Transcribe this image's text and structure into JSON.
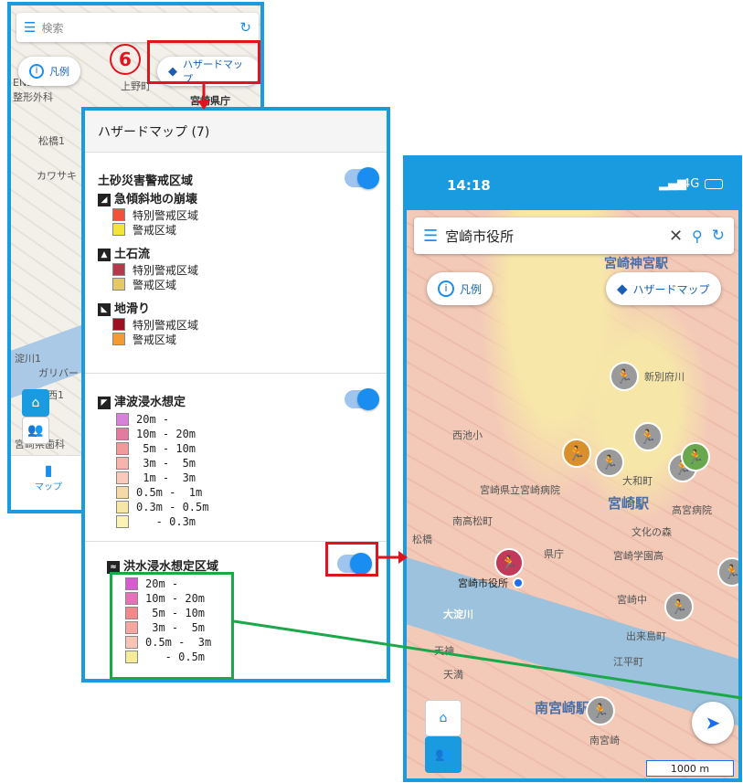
{
  "phone1": {
    "search_placeholder": "検索",
    "legend_label": "凡例",
    "hazard_label": "ハザードマップ",
    "nav_label": "マップ",
    "map_labels": [
      "ENEOS",
      "整形外科",
      "上野町",
      "宮崎県庁",
      "松橋1",
      "カワサキ",
      "淀川1",
      "ガリバー",
      "中村西1",
      "宮崎県歯科"
    ]
  },
  "hazard_panel": {
    "title": "ハザードマップ (7)",
    "landslide": {
      "title": "土砂災害警戒区域",
      "groups": [
        {
          "name": "急傾斜地の崩壊",
          "items": [
            {
              "label": "特別警戒区域",
              "color": "#f0533a"
            },
            {
              "label": "警戒区域",
              "color": "#f6e33a"
            }
          ]
        },
        {
          "name": "土石流",
          "items": [
            {
              "label": "特別警戒区域",
              "color": "#b23a4a"
            },
            {
              "label": "警戒区域",
              "color": "#e4c86a"
            }
          ]
        },
        {
          "name": "地滑り",
          "items": [
            {
              "label": "特別警戒区域",
              "color": "#9c1020"
            },
            {
              "label": "警戒区域",
              "color": "#f49a34"
            }
          ]
        }
      ]
    },
    "tsunami": {
      "title": "津波浸水想定",
      "items": [
        {
          "label": "20m -",
          "color": "#d582d8"
        },
        {
          "label": "10m - 20m",
          "color": "#e37aa0"
        },
        {
          "label": " 5m - 10m",
          "color": "#f19a9c"
        },
        {
          "label": " 3m -  5m",
          "color": "#f6b4ae"
        },
        {
          "label": " 1m -  3m",
          "color": "#f8c9bc"
        },
        {
          "label": "0.5m -  1m",
          "color": "#f6d9a8"
        },
        {
          "label": "0.3m - 0.5m",
          "color": "#f7e7a6"
        },
        {
          "label": "   - 0.3m",
          "color": "#fbf3b6"
        }
      ]
    },
    "flood": {
      "title": "洪水浸水想定区域",
      "items": [
        {
          "label": "20m -",
          "color": "#d45bd0"
        },
        {
          "label": "10m - 20m",
          "color": "#e472b8"
        },
        {
          "label": " 5m - 10m",
          "color": "#f08a8a"
        },
        {
          "label": " 3m -  5m",
          "color": "#f6a6a0"
        },
        {
          "label": "0.5m -  3m",
          "color": "#f8c4b6"
        },
        {
          "label": "   - 0.5m",
          "color": "#f3ec98"
        }
      ]
    }
  },
  "phone2": {
    "time": "14:18",
    "network": "4G",
    "search_value": "宮崎市役所",
    "legend_label": "凡例",
    "hazard_label": "ハザードマップ",
    "scale_label": "1000 m",
    "map_labels": [
      "宮崎神宮駅",
      "宮崎駅",
      "南宮崎駅",
      "宮崎市役所",
      "県庁",
      "宮崎中",
      "大淀川",
      "宮崎県立宮崎病院",
      "文化の森",
      "宮崎学園高",
      "大和町",
      "出来島町",
      "高宮病院",
      "天満",
      "南宮崎",
      "江平町",
      "天神",
      "松橋",
      "西池小",
      "南高松町",
      "新別府川"
    ]
  },
  "annotations": {
    "step_number": "6",
    "colors": {
      "accent_blue": "#1a9be0",
      "red_highlight": "#e0141e",
      "green_highlight": "#1aa84a"
    }
  }
}
